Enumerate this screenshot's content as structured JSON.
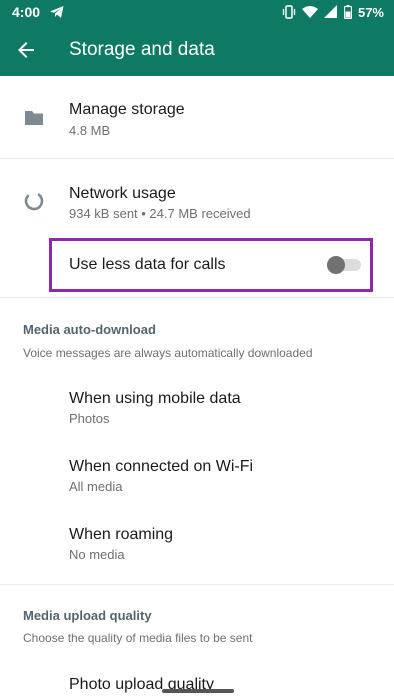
{
  "status_bar": {
    "time": "4:00",
    "battery": "57%",
    "icons": [
      "telegram-icon",
      "vibrate-icon",
      "wifi-icon",
      "signal-icon",
      "battery-icon"
    ]
  },
  "app_bar": {
    "title": "Storage and data",
    "back_icon": "back-arrow-icon"
  },
  "storage": {
    "manage_label": "Manage storage",
    "manage_value": "4.8 MB",
    "network_label": "Network usage",
    "network_value": "934 kB sent • 24.7 MB received",
    "less_data_label": "Use less data for calls",
    "less_data_enabled": false
  },
  "media_auto_download": {
    "title": "Media auto-download",
    "subtitle": "Voice messages are always automatically downloaded",
    "items": [
      {
        "label": "When using mobile data",
        "value": "Photos"
      },
      {
        "label": "When connected on Wi-Fi",
        "value": "All media"
      },
      {
        "label": "When roaming",
        "value": "No media"
      }
    ]
  },
  "media_upload_quality": {
    "title": "Media upload quality",
    "subtitle": "Choose the quality of media files to be sent",
    "photo_label": "Photo upload quality"
  },
  "colors": {
    "appbar": "#0e7a63",
    "highlight_border": "#8e27ad",
    "section_title": "#54656f"
  }
}
